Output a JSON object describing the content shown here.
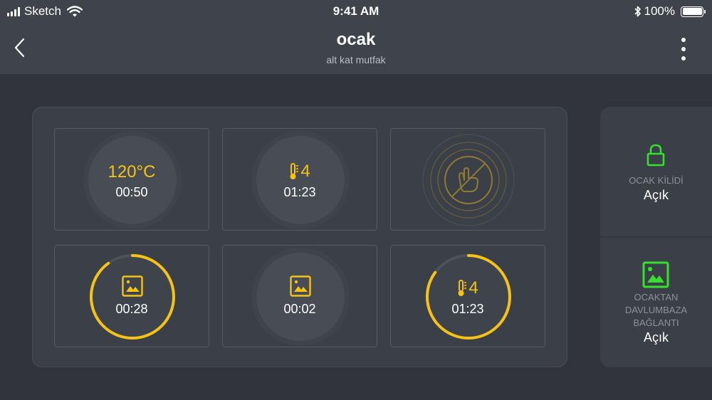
{
  "status_bar": {
    "carrier": "Sketch",
    "time": "9:41 AM",
    "battery": "100%"
  },
  "header": {
    "title": "ocak",
    "subtitle": "alt kat mutfak"
  },
  "burners": [
    {
      "line1": "120°C",
      "line2": "00:50",
      "progress": null
    },
    {
      "line1": "4",
      "line2": "01:23",
      "progress": null
    },
    {
      "line1": "",
      "line2": "",
      "progress": null
    },
    {
      "line1": "",
      "line2": "00:28",
      "progress": 0.9
    },
    {
      "line1": "",
      "line2": "00:02",
      "progress": null
    },
    {
      "line1": "4",
      "line2": "01:23",
      "progress": 0.85
    }
  ],
  "side_panel": {
    "lock": {
      "label": "OCAK KİLİDİ",
      "value": "Açık"
    },
    "hood": {
      "label_lines": [
        "OCAKTAN",
        "DAVLUMBAZA",
        "BAĞLANTI"
      ],
      "value": "Açık"
    }
  },
  "colors": {
    "accent": "#f4c315",
    "success": "#35e02e",
    "background": "#31343c",
    "bar": "#3f434c"
  },
  "icons": [
    "signal-icon",
    "wifi-icon",
    "bluetooth-icon",
    "battery-icon",
    "back-icon",
    "more-icon",
    "thermometer-icon",
    "image-icon",
    "hand-off-icon",
    "lock-icon"
  ]
}
